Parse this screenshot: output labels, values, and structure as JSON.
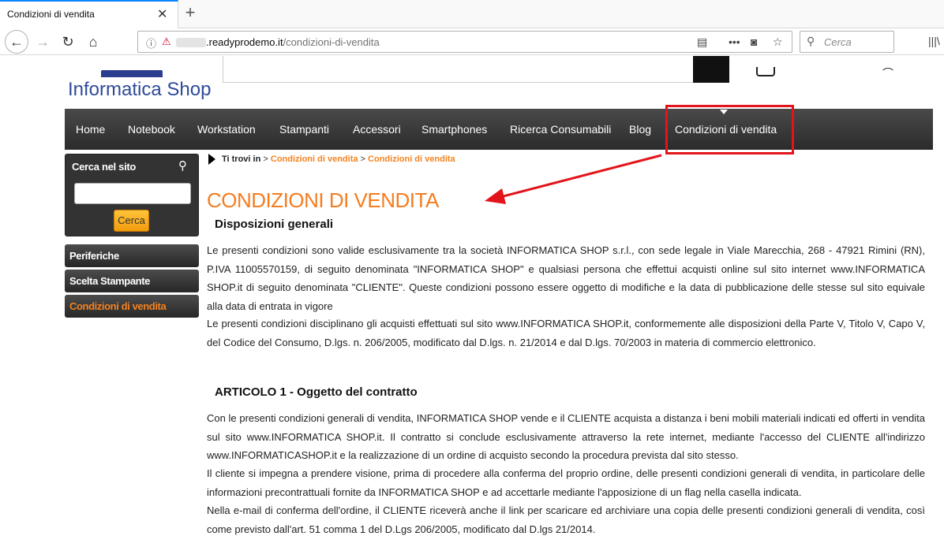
{
  "browser": {
    "tab_title": "Condizioni di vendita",
    "tab_close": "✕",
    "new_tab": "+",
    "url_host": ".readyprodemo.it",
    "url_path": "/condizioni-di-vendita",
    "search_placeholder": "Cerca"
  },
  "site": {
    "logo": "Informatica Shop"
  },
  "main_nav": [
    "Home",
    "Notebook",
    "Workstation",
    "Stampanti",
    "Accessori",
    "Smartphones",
    "Ricerca Consumabili",
    "Blog",
    "Condizioni di vendita"
  ],
  "sidebar": {
    "search_title": "Cerca nel sito",
    "search_button": "Cerca",
    "links": [
      "Periferiche",
      "Scelta Stampante",
      "Condizioni di vendita"
    ]
  },
  "breadcrumb": {
    "label": "Ti trovi in",
    "sep": ">",
    "items": [
      "Condizioni di vendita",
      "Condizioni di vendita"
    ]
  },
  "content": {
    "title": "CONDIZIONI DI VENDITA",
    "section1_title": "Disposizioni generali",
    "section1_p1": "Le presenti condizioni sono valide esclusivamente tra la società INFORMATICA SHOP s.r.l., con sede legale in Viale Marecchia, 268 - 47921 Rimini (RN), P.IVA 11005570159, di seguito denominata \"INFORMATICA SHOP\" e qualsiasi persona che effettui acquisti online sul sito internet www.INFORMATICA SHOP.it di seguito denominata \"CLIENTE\". Queste condizioni possono essere oggetto di modifiche e la data di pubblicazione delle stesse sul sito equivale alla data di entrata in vigore",
    "section1_p2": "Le presenti condizioni disciplinano gli acquisti effettuati sul sito www.INFORMATICA SHOP.it, conformemente alle disposizioni della Parte V, Titolo V, Capo V, del Codice del Consumo, D.lgs. n. 206/2005, modificato dal D.lgs. n. 21/2014 e dal D.lgs. 70/2003 in materia di commercio elettronico.",
    "section2_title": "ARTICOLO 1 - Oggetto del contratto",
    "section2_p1": "Con le presenti condizioni generali di vendita, INFORMATICA SHOP vende e il CLIENTE acquista a distanza i beni mobili materiali indicati ed offerti in vendita sul sito www.INFORMATICA SHOP.it. Il contratto si conclude esclusivamente attraverso la rete internet, mediante l'accesso del CLIENTE all'indirizzo www.INFORMATICASHOP.it e la realizzazione di un ordine di acquisto secondo la procedura prevista dal sito stesso.",
    "section2_p2": "Il cliente si impegna a prendere visione, prima di procedere alla conferma del proprio ordine, delle presenti condizioni generali di vendita, in particolare delle informazioni precontrattuali fornite da INFORMATICA SHOP e ad accettarle mediante l'apposizione di un flag nella casella indicata.",
    "section2_p3": "Nella e-mail di conferma dell'ordine, il CLIENTE riceverà anche il link per scaricare ed archiviare una copia delle presenti condizioni generali di vendita, così come previsto dall'art. 51 comma 1 del D.Lgs 206/2005, modificato dal D.lgs 21/2014."
  },
  "colors": {
    "accent": "#f47d20",
    "annotation": "#e3141b",
    "logo": "#2e4a9c"
  }
}
